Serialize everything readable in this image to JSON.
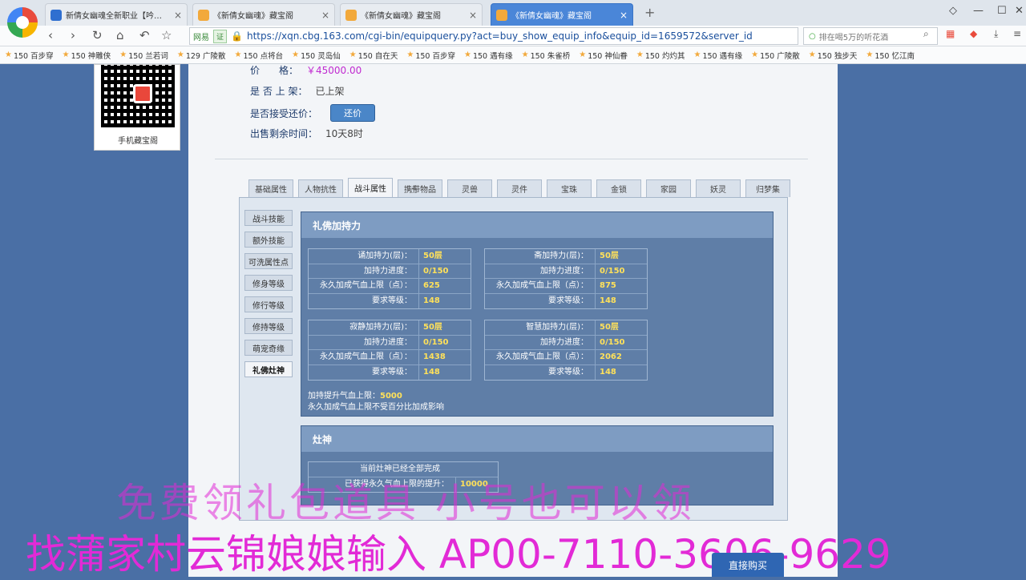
{
  "browser": {
    "tabs": [
      {
        "title": "新倩女幽魂全新职业【吟凋】上",
        "close": "×"
      },
      {
        "title": "《新倩女幽魂》藏宝阁",
        "close": "×"
      },
      {
        "title": "《新倩女幽魂》藏宝阁",
        "close": "×"
      },
      {
        "title": "《新倩女幽魂》藏宝阁",
        "close": "×"
      }
    ],
    "new_tab": "+",
    "security": "网易",
    "security_badge": "证",
    "url": "https://xqn.cbg.163.com/cgi-bin/equipquery.py?act=buy_show_equip_info&equip_id=1659572&server_id",
    "search_text": "排在喝5万的听花酒",
    "bookmarks": [
      "150 百步穿",
      "150 神雕侠",
      "150 兰若词",
      "129 广陵散",
      "150 点将台",
      "150 灵岛仙",
      "150 自在天",
      "150 百步穿",
      "150 遇有缘",
      "150 朱雀桥",
      "150 神仙眷",
      "150 灼灼其",
      "150 遇有缘",
      "150 广陵散",
      "150 独步天",
      "150 忆江南"
    ]
  },
  "qr": {
    "label": "手机藏宝阁"
  },
  "info": {
    "price_label": "价　　格：",
    "price_value": "￥45000.00",
    "listed_label": "是 否 上 架：",
    "listed_value": "已上架",
    "counter_label": "是否接受还价：",
    "counter_button": "还价",
    "time_label": "出售剩余时间：",
    "time_value": "10天8时"
  },
  "property_tabs": [
    "基础属性",
    "人物抗性",
    "战斗属性",
    "携带物品",
    "灵兽",
    "灵件",
    "宝珠",
    "金锁",
    "家园",
    "妖灵",
    "归梦集"
  ],
  "side_nav": [
    "战斗技能",
    "额外技能",
    "可洗属性点",
    "修身等级",
    "修行等级",
    "修持等级",
    "萌宠奇缘",
    "礼佛灶神"
  ],
  "blessing": {
    "title": "礼佛加持力",
    "tables": [
      {
        "rows": [
          [
            "诵加持力(层)：",
            "50层"
          ],
          [
            "加持力进度：",
            "0/150"
          ],
          [
            "永久加成气血上限（点）：",
            "625"
          ],
          [
            "要求等级：",
            "148"
          ]
        ]
      },
      {
        "rows": [
          [
            "斋加持力(层)：",
            "50层"
          ],
          [
            "加持力进度：",
            "0/150"
          ],
          [
            "永久加成气血上限（点）：",
            "875"
          ],
          [
            "要求等级：",
            "148"
          ]
        ]
      },
      {
        "rows": [
          [
            "寂静加持力(层)：",
            "50层"
          ],
          [
            "加持力进度：",
            "0/150"
          ],
          [
            "永久加成气血上限（点）：",
            "1438"
          ],
          [
            "要求等级：",
            "148"
          ]
        ]
      },
      {
        "rows": [
          [
            "智慧加持力(层)：",
            "50层"
          ],
          [
            "加持力进度：",
            "0/150"
          ],
          [
            "永久加成气血上限（点）：",
            "2062"
          ],
          [
            "要求等级：",
            "148"
          ]
        ]
      }
    ],
    "note1_label": "加持提升气血上限：",
    "note1_value": "5000",
    "note2": "永久加成气血上限不受百分比加成影响"
  },
  "kitchen_god": {
    "title": "灶神",
    "status": "当前灶神已经全部完成",
    "gain_label": "已获得永久气血上限的提升：",
    "gain_value": "10000"
  },
  "overlay": {
    "line1": "免费领礼包道具 小号也可以领",
    "line2": "找蒲家村云锦娘娘输入 AP00-7110-3606-9629"
  },
  "buy_button": "直接购买"
}
